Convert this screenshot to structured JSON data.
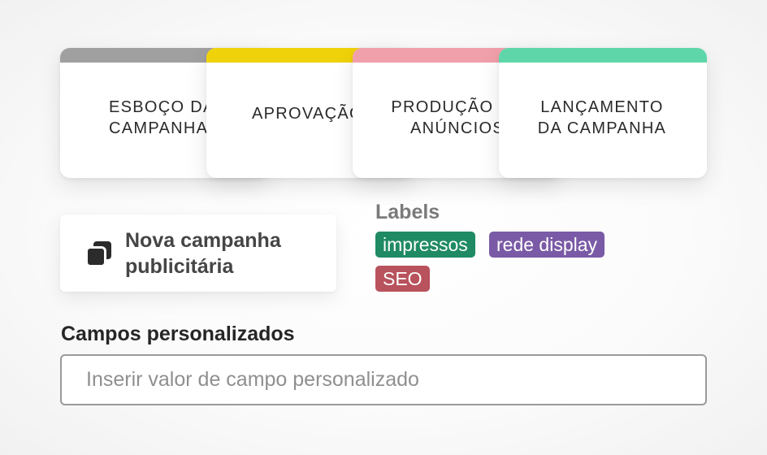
{
  "stages": [
    {
      "label": "ESBOÇO DA\nCAMPANHA",
      "color": "#a0a0a0"
    },
    {
      "label": "APROVAÇÃO",
      "color": "#f0d20a"
    },
    {
      "label": "PRODUÇÃO DE\nANÚNCIOS",
      "color": "#f0a0aa"
    },
    {
      "label": "LANÇAMENTO\nDA CAMPANHA",
      "color": "#5fd6aa"
    }
  ],
  "task": {
    "icon": "copy-icon",
    "title": "Nova campanha publicitária"
  },
  "labels": {
    "heading": "Labels",
    "chips": [
      {
        "text": "impressos",
        "color": "#1f8a63"
      },
      {
        "text": "rede display",
        "color": "#7a5aa6"
      },
      {
        "text": "SEO",
        "color": "#b8525c"
      }
    ]
  },
  "custom_fields": {
    "heading": "Campos personalizados",
    "placeholder": "Inserir valor de campo personalizado",
    "value": ""
  }
}
